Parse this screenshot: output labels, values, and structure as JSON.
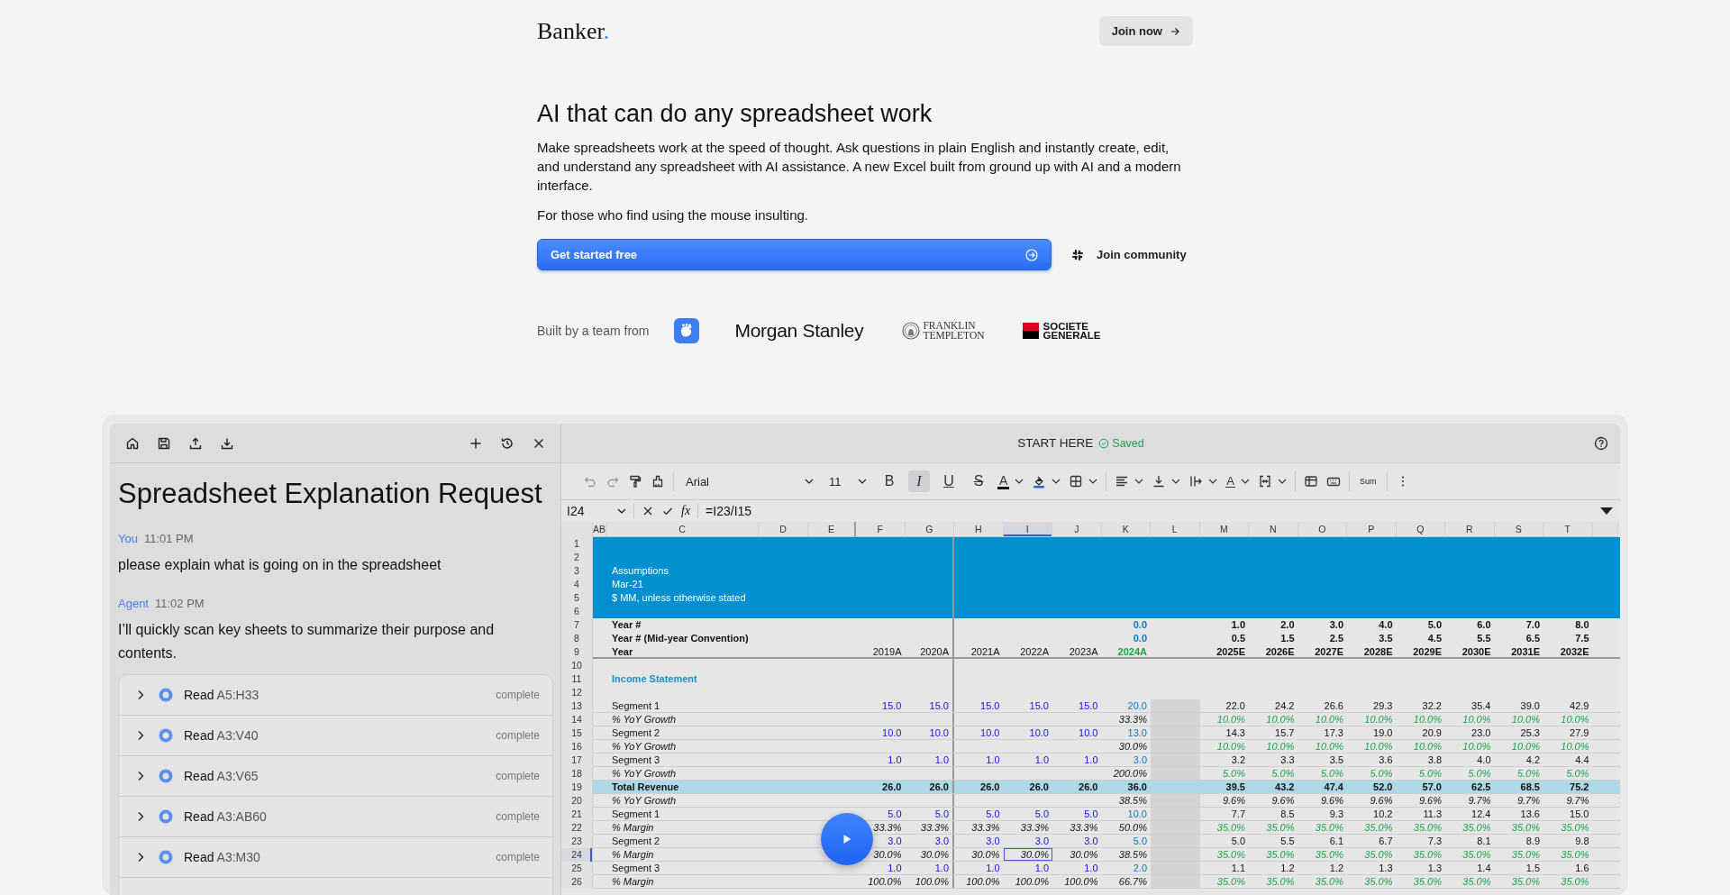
{
  "header": {
    "logo": "Banker",
    "logo_dot": ".",
    "cta": "Join now"
  },
  "hero": {
    "title": "AI that can do any spreadsheet work",
    "description": "Make spreadsheets work at the speed of thought. Ask questions in plain English and instantly create, edit, and understand any spreadsheet with AI assistance. A new Excel built from ground up with AI and a modern interface.",
    "tagline": "For those who find using the mouse insulting.",
    "primary": "Get started free",
    "secondary": "Join community"
  },
  "partners": {
    "label": "Built by a team from",
    "logos": [
      {
        "kind": "icon"
      },
      {
        "kind": "wordmark",
        "lines": [
          "Morgan Stanley"
        ]
      },
      {
        "kind": "serif",
        "lines": [
          "FRANKLIN",
          "TEMPLETON"
        ]
      },
      {
        "kind": "flag",
        "lines": [
          "SOCIETE",
          "GENERALE"
        ]
      }
    ]
  },
  "app": {
    "title": "START HERE",
    "status": "Saved"
  },
  "chat": {
    "title": "Spreadsheet Explanation Request",
    "messages": [
      {
        "author": "You",
        "time": "11:01 PM",
        "text": "please explain what is going on in the spreadsheet"
      },
      {
        "author": "Agent",
        "time": "11:02 PM",
        "text": "I’ll quickly scan key sheets to summarize their purpose and contents."
      }
    ],
    "steps": [
      {
        "action": "Read",
        "range": "A5:H33",
        "status": "complete"
      },
      {
        "action": "Read",
        "range": "A3:V40",
        "status": "complete"
      },
      {
        "action": "Read",
        "range": "A3:V65",
        "status": "complete"
      },
      {
        "action": "Read",
        "range": "A3:AB60",
        "status": "complete"
      },
      {
        "action": "Read",
        "range": "A3:M30",
        "status": "complete"
      }
    ]
  },
  "spreadsheet": {
    "toolbar": {
      "font": "Arial",
      "size": "11",
      "styles": [
        {
          "glyph": "B",
          "selected": false
        },
        {
          "glyph": "I",
          "selected": true
        },
        {
          "glyph": "U",
          "selected": false
        },
        {
          "glyph": "S",
          "selected": false
        }
      ],
      "text_color": "A",
      "rotate": "A",
      "sum": "Sum"
    },
    "formula_bar": {
      "cell": "I24",
      "fx": "fx",
      "formula": "=I23/I15"
    },
    "columns": [
      {
        "label": "AB",
        "selected": false
      },
      {
        "label": "C",
        "selected": false
      },
      {
        "label": "D",
        "selected": false
      },
      {
        "label": "E",
        "selected": false
      },
      {
        "label": "F",
        "selected": false
      },
      {
        "label": "G",
        "selected": false
      },
      {
        "label": "H",
        "selected": false
      },
      {
        "label": "I",
        "selected": true
      },
      {
        "label": "J",
        "selected": false
      },
      {
        "label": "K",
        "selected": false
      },
      {
        "label": "L",
        "selected": false
      },
      {
        "label": "M",
        "selected": false
      },
      {
        "label": "N",
        "selected": false
      },
      {
        "label": "O",
        "selected": false
      },
      {
        "label": "P",
        "selected": false
      },
      {
        "label": "Q",
        "selected": false
      },
      {
        "label": "R",
        "selected": false
      },
      {
        "label": "S",
        "selected": false
      },
      {
        "label": "T",
        "selected": false
      }
    ],
    "rows": [
      {
        "n": "1",
        "kind": "band",
        "selected": false
      },
      {
        "n": "2",
        "kind": "band",
        "selected": false
      },
      {
        "n": "3",
        "kind": "band",
        "selected": false,
        "label": "Assumptions"
      },
      {
        "n": "4",
        "kind": "band",
        "selected": false,
        "label": "Mar-21"
      },
      {
        "n": "5",
        "kind": "band",
        "selected": false,
        "label": "$ MM, unless otherwise stated"
      },
      {
        "n": "6",
        "kind": "band",
        "selected": false
      },
      {
        "n": "7",
        "kind": "heading",
        "selected": false,
        "label": "Year #",
        "base": {
          "kind": "link",
          "value": "0.0"
        },
        "proj": {
          "kind": "calc",
          "values": [
            "1.0",
            "2.0",
            "3.0",
            "4.0",
            "5.0",
            "6.0",
            "7.0",
            "8.0"
          ]
        }
      },
      {
        "n": "8",
        "kind": "heading",
        "selected": false,
        "label": "Year # (Mid-year Convention)",
        "base": {
          "kind": "link",
          "value": "0.0"
        },
        "proj": {
          "kind": "calc",
          "values": [
            "0.5",
            "1.5",
            "2.5",
            "3.5",
            "4.5",
            "5.5",
            "6.5",
            "7.5"
          ]
        }
      },
      {
        "n": "9",
        "kind": "heading",
        "selected": false,
        "label": "Year",
        "hist": {
          "kind": "plain",
          "values": [
            "2019A",
            "2020A",
            "2021A",
            "2022A",
            "2023A"
          ]
        },
        "base": {
          "kind": "highlight",
          "value": "2024A"
        },
        "proj": {
          "kind": "calc",
          "values": [
            "2025E",
            "2026E",
            "2027E",
            "2028E",
            "2029E",
            "2030E",
            "2031E",
            "2032E"
          ]
        }
      },
      {
        "n": "10",
        "kind": "plain",
        "selected": false
      },
      {
        "n": "11",
        "kind": "section",
        "selected": false,
        "label": "Income Statement"
      },
      {
        "n": "12",
        "kind": "plain",
        "selected": false
      },
      {
        "n": "13",
        "kind": "plain",
        "selected": false,
        "label": "Segment 1",
        "hist": {
          "kind": "input",
          "values": [
            "15.0",
            "15.0",
            "15.0",
            "15.0",
            "15.0"
          ]
        },
        "base": {
          "kind": "link",
          "value": "20.0"
        },
        "proj": {
          "kind": "calc",
          "values": [
            "22.0",
            "24.2",
            "26.6",
            "29.3",
            "32.2",
            "35.4",
            "39.0",
            "42.9"
          ]
        }
      },
      {
        "n": "14",
        "kind": "italic",
        "selected": false,
        "label": "% YoY Growth",
        "base": {
          "kind": "calc",
          "value": "33.3%"
        },
        "proj": {
          "kind": "assumption",
          "values": [
            "10.0%",
            "10.0%",
            "10.0%",
            "10.0%",
            "10.0%",
            "10.0%",
            "10.0%",
            "10.0%"
          ]
        }
      },
      {
        "n": "15",
        "kind": "plain",
        "selected": false,
        "label": "Segment 2",
        "hist": {
          "kind": "input",
          "values": [
            "10.0",
            "10.0",
            "10.0",
            "10.0",
            "10.0"
          ]
        },
        "base": {
          "kind": "link",
          "value": "13.0"
        },
        "proj": {
          "kind": "calc",
          "values": [
            "14.3",
            "15.7",
            "17.3",
            "19.0",
            "20.9",
            "23.0",
            "25.3",
            "27.9"
          ]
        }
      },
      {
        "n": "16",
        "kind": "italic",
        "selected": false,
        "label": "% YoY Growth",
        "base": {
          "kind": "calc",
          "value": "30.0%"
        },
        "proj": {
          "kind": "assumption",
          "values": [
            "10.0%",
            "10.0%",
            "10.0%",
            "10.0%",
            "10.0%",
            "10.0%",
            "10.0%",
            "10.0%"
          ]
        }
      },
      {
        "n": "17",
        "kind": "plain",
        "selected": false,
        "label": "Segment 3",
        "hist": {
          "kind": "input",
          "values": [
            "1.0",
            "1.0",
            "1.0",
            "1.0",
            "1.0"
          ]
        },
        "base": {
          "kind": "link",
          "value": "3.0"
        },
        "proj": {
          "kind": "calc",
          "values": [
            "3.2",
            "3.3",
            "3.5",
            "3.6",
            "3.8",
            "4.0",
            "4.2",
            "4.4"
          ]
        }
      },
      {
        "n": "18",
        "kind": "italic",
        "selected": false,
        "label": "% YoY Growth",
        "base": {
          "kind": "calc",
          "value": "200.0%"
        },
        "proj": {
          "kind": "assumption",
          "values": [
            "5.0%",
            "5.0%",
            "5.0%",
            "5.0%",
            "5.0%",
            "5.0%",
            "5.0%",
            "5.0%"
          ]
        }
      },
      {
        "n": "19",
        "kind": "total",
        "selected": false,
        "label": "Total Revenue",
        "hist": {
          "kind": "calc",
          "values": [
            "26.0",
            "26.0",
            "26.0",
            "26.0",
            "26.0"
          ]
        },
        "base": {
          "kind": "calc",
          "value": "36.0"
        },
        "proj": {
          "kind": "calc",
          "values": [
            "39.5",
            "43.2",
            "47.4",
            "52.0",
            "57.0",
            "62.5",
            "68.5",
            "75.2"
          ]
        }
      },
      {
        "n": "20",
        "kind": "italic",
        "selected": false,
        "label": "% YoY Growth",
        "base": {
          "kind": "calc",
          "value": "38.5%"
        },
        "proj": {
          "kind": "calc",
          "values": [
            "9.6%",
            "9.6%",
            "9.6%",
            "9.6%",
            "9.6%",
            "9.7%",
            "9.7%",
            "9.7%"
          ]
        }
      },
      {
        "n": "21",
        "kind": "plain",
        "selected": false,
        "label": "Segment 1",
        "hist": {
          "kind": "input",
          "values": [
            "5.0",
            "5.0",
            "5.0",
            "5.0",
            "5.0"
          ]
        },
        "base": {
          "kind": "link",
          "value": "10.0"
        },
        "proj": {
          "kind": "calc",
          "values": [
            "7.7",
            "8.5",
            "9.3",
            "10.2",
            "11.3",
            "12.4",
            "13.6",
            "15.0"
          ]
        }
      },
      {
        "n": "22",
        "kind": "italic",
        "selected": false,
        "label": "% Margin",
        "hist": {
          "kind": "calc",
          "values": [
            "33.3%",
            "33.3%",
            "33.3%",
            "33.3%",
            "33.3%"
          ]
        },
        "base": {
          "kind": "calc",
          "value": "50.0%"
        },
        "proj": {
          "kind": "assumption",
          "values": [
            "35.0%",
            "35.0%",
            "35.0%",
            "35.0%",
            "35.0%",
            "35.0%",
            "35.0%",
            "35.0%"
          ]
        }
      },
      {
        "n": "23",
        "kind": "plain",
        "selected": false,
        "label": "Segment 2",
        "hist": {
          "kind": "input",
          "values": [
            "3.0",
            "3.0",
            "3.0",
            "3.0",
            "3.0"
          ]
        },
        "base": {
          "kind": "link",
          "value": "5.0"
        },
        "proj": {
          "kind": "calc",
          "values": [
            "5.0",
            "5.5",
            "6.1",
            "6.7",
            "7.3",
            "8.1",
            "8.9",
            "9.8"
          ]
        }
      },
      {
        "n": "24",
        "kind": "italic",
        "selected": true,
        "label": "% Margin",
        "hist": {
          "kind": "calc",
          "values": [
            "30.0%",
            "30.0%",
            "30.0%",
            "30.0%",
            "30.0%"
          ]
        },
        "base": {
          "kind": "calc",
          "value": "38.5%"
        },
        "proj": {
          "kind": "assumption",
          "values": [
            "35.0%",
            "35.0%",
            "35.0%",
            "35.0%",
            "35.0%",
            "35.0%",
            "35.0%",
            "35.0%"
          ]
        }
      },
      {
        "n": "25",
        "kind": "plain",
        "selected": false,
        "label": "Segment 3",
        "hist": {
          "kind": "input",
          "values": [
            "1.0",
            "1.0",
            "1.0",
            "1.0",
            "1.0"
          ]
        },
        "base": {
          "kind": "link",
          "value": "2.0"
        },
        "proj": {
          "kind": "calc",
          "values": [
            "1.1",
            "1.2",
            "1.2",
            "1.3",
            "1.3",
            "1.4",
            "1.5",
            "1.6"
          ]
        }
      },
      {
        "n": "26",
        "kind": "italic",
        "selected": false,
        "label": "% Margin",
        "hist": {
          "kind": "calc",
          "values": [
            "100.0%",
            "100.0%",
            "100.0%",
            "100.0%",
            "100.0%"
          ]
        },
        "base": {
          "kind": "calc",
          "value": "66.7%"
        },
        "proj": {
          "kind": "assumption",
          "values": [
            "35.0%",
            "35.0%",
            "35.0%",
            "35.0%",
            "35.0%",
            "35.0%",
            "35.0%",
            "35.0%"
          ]
        }
      }
    ]
  }
}
